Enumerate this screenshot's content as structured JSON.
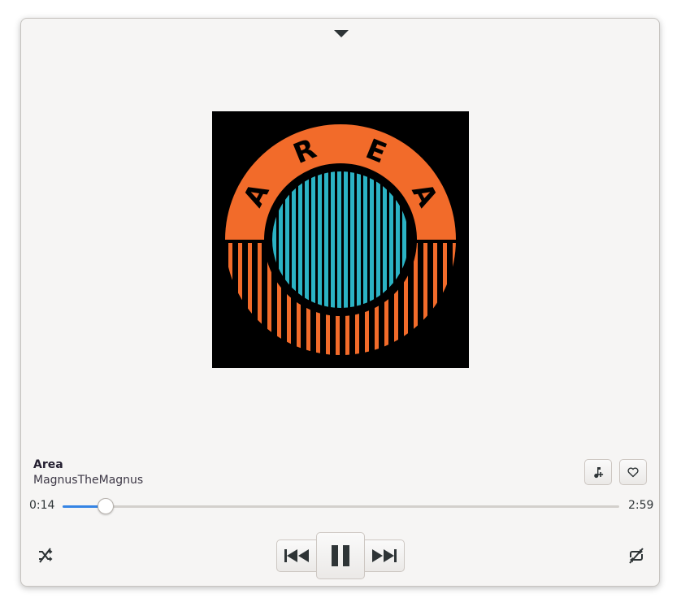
{
  "track": {
    "title": "Area",
    "artist": "MagnusTheMagnus",
    "elapsed": "0:14",
    "duration": "2:59",
    "progress": 0.078
  },
  "album_art": {
    "text": "AREA",
    "colors": {
      "background": "#000000",
      "ring": "#f26b2a",
      "center": "#2bb3c4"
    }
  },
  "icons": {
    "collapse": "pan-down-icon",
    "add_to_playlist": "music-note-add-icon",
    "favorite": "heart-outline-icon",
    "shuffle": "shuffle-disabled-icon",
    "previous": "skip-previous-icon",
    "play_pause": "pause-icon",
    "next": "skip-next-icon",
    "repeat": "repeat-disabled-icon"
  },
  "accent_color": "#3584e4"
}
